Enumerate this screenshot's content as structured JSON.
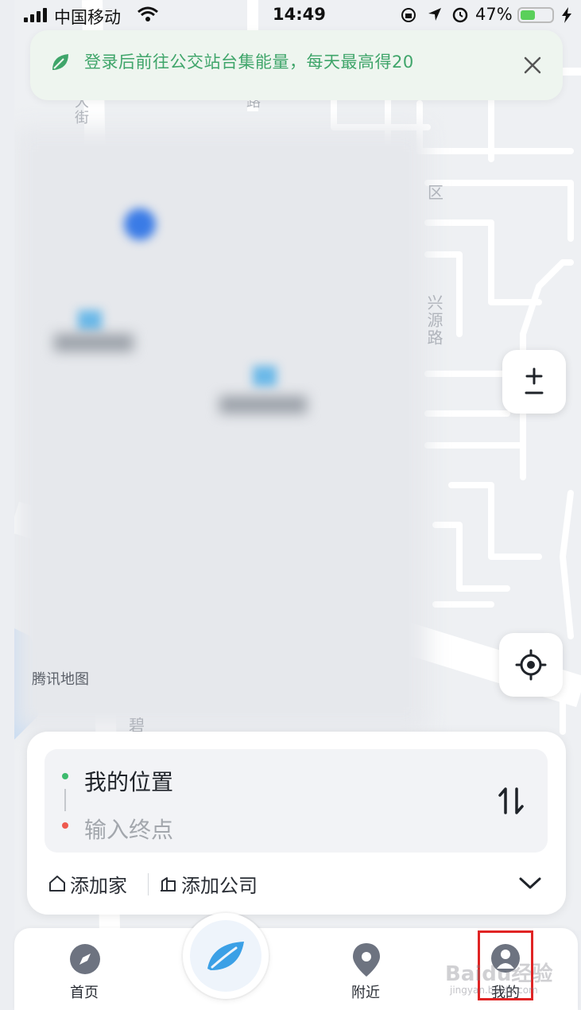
{
  "status_bar": {
    "carrier": "中国移动",
    "time": "14:49",
    "battery": "47%",
    "battery_level": 0.47
  },
  "banner": {
    "text": "登录后前往公交站台集能量，每天最高得20",
    "leaf_icon": "leaf-icon",
    "close_icon": "close-icon"
  },
  "map": {
    "watermark": "腾讯地图",
    "street_xingyuan": "兴源路",
    "street_dajie": "大街",
    "street_lu": "路",
    "district": "区",
    "street_bottom": "碧"
  },
  "controls": {
    "zoom_icon": "plus-minus-icon",
    "locate_icon": "crosshair-icon"
  },
  "route": {
    "from": "我的位置",
    "to_placeholder": "输入终点",
    "swap_icon": "swap-arrows-icon"
  },
  "quick_actions": {
    "home": "添加家",
    "company": "添加公司",
    "expand_icon": "chevron-down-icon"
  },
  "tabs": [
    {
      "label": "首页",
      "icon": "compass-icon"
    },
    {
      "label": "",
      "icon": "leaf-icon"
    },
    {
      "label": "附近",
      "icon": "location-pin-icon"
    },
    {
      "label": "我的",
      "icon": "user-icon"
    }
  ],
  "overlay": {
    "watermark": "Baidu经验",
    "watermark_sub": "jingyan.baidu.com"
  },
  "colors": {
    "accent_green": "#3fa56a",
    "origin_dot": "#3dbb6e",
    "destination_dot": "#ee5a4f",
    "highlight": "#e02424",
    "tab_icon": "#6d7380",
    "center_leaf": "#3ba0e6"
  }
}
